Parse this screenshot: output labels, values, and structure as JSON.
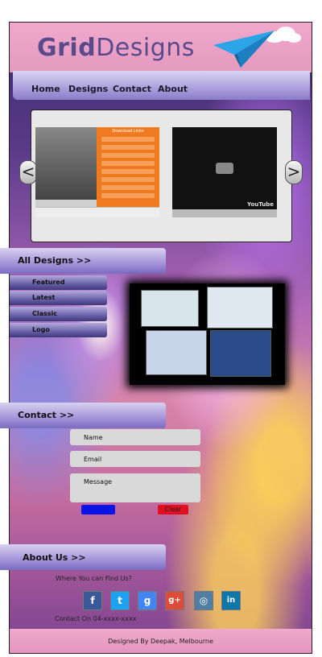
{
  "header": {
    "logo_bold": "Grid",
    "logo_rest": "Designs"
  },
  "nav": {
    "items": [
      "Home",
      "Designs",
      "Contact",
      "About"
    ]
  },
  "slider": {
    "prev": "<",
    "next": ">",
    "video1_title": "Download Links",
    "video2_brand": "YouTube"
  },
  "designs": {
    "heading": "All Designs >>",
    "items": [
      "Featured",
      "Latest",
      "Classic",
      "Logo"
    ]
  },
  "contact": {
    "heading": "Contact  >>",
    "name_placeholder": "Name",
    "email_placeholder": "Email",
    "message_placeholder": "Message",
    "send_label": "Send",
    "clear_label": "Clear"
  },
  "about": {
    "heading": "About Us  >>",
    "find_us": "Where You can Find Us?",
    "contact_on": "Contact On 04-xxxx-xxxx",
    "social": [
      {
        "icon": "facebook-icon",
        "glyph": "f",
        "color": "#3b5998"
      },
      {
        "icon": "twitter-icon",
        "glyph": "t",
        "color": "#1da1f2"
      },
      {
        "icon": "google-icon",
        "glyph": "g",
        "color": "#4285f4"
      },
      {
        "icon": "google-plus-icon",
        "glyph": "g+",
        "color": "#dd4b39"
      },
      {
        "icon": "instagram-icon",
        "glyph": "◎",
        "color": "#517fa4"
      },
      {
        "icon": "linkedin-icon",
        "glyph": "in",
        "color": "#0e76a8"
      }
    ]
  },
  "footer": {
    "text": "Designed By Deepak, Melbourne"
  }
}
